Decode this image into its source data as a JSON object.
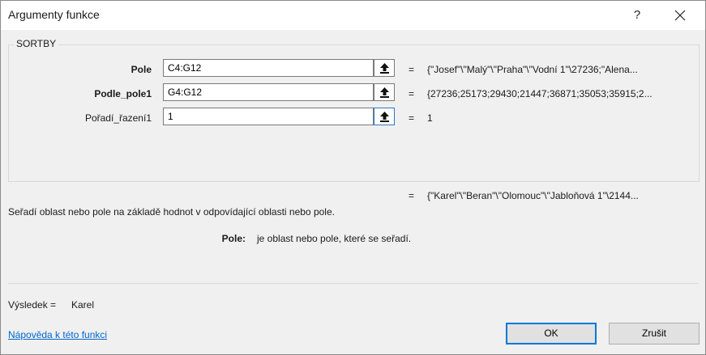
{
  "window": {
    "title": "Argumenty funkce",
    "help_glyph": "?"
  },
  "function_name": "SORTBY",
  "args": [
    {
      "label": "Pole",
      "value": "C4:G12",
      "result": "{\"Josef\"\\\"Malý\"\\\"Praha\"\\\"Vodní 1\"\\27236;\"Alena..."
    },
    {
      "label": "Podle_pole1",
      "value": "G4:G12",
      "result": "{27236;25173;29430;21447;36871;35053;35915;2..."
    },
    {
      "label": "Pořadí_řazení1",
      "value": "1",
      "result": "1"
    }
  ],
  "equals_sign": "=",
  "overall_result": "{\"Karel\"\\\"Beran\"\\\"Olomouc\"\\\"Jabloňová 1\"\\2144...",
  "description": "Seřadí oblast nebo pole na základě hodnot v odpovídající oblasti nebo pole.",
  "param_help": {
    "name": "Pole:",
    "text": "je oblast nebo pole, které se seřadí."
  },
  "result_label": "Výsledek =",
  "result_value": "Karel",
  "help_link": "Nápověda k této funkci",
  "buttons": {
    "ok": "OK",
    "cancel": "Zrušit"
  }
}
